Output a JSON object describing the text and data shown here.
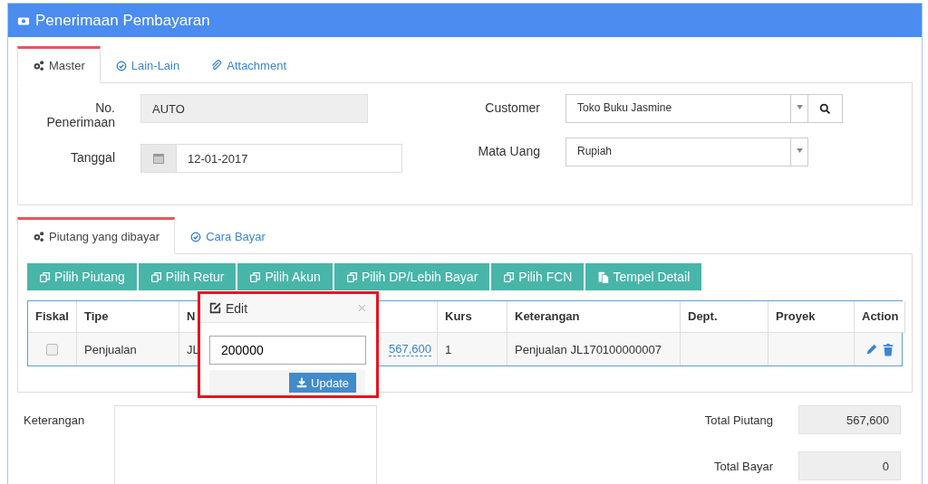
{
  "window": {
    "title": "Penerimaan Pembayaran"
  },
  "master_tabs": [
    {
      "label": "Master",
      "selected": true
    },
    {
      "label": "Lain-Lain",
      "selected": false
    },
    {
      "label": "Attachment",
      "selected": false
    }
  ],
  "master": {
    "no_penerimaan": {
      "label": "No. Penerimaan",
      "value": "AUTO",
      "disabled": true
    },
    "tanggal": {
      "label": "Tanggal",
      "value": "12-01-2017"
    },
    "customer": {
      "label": "Customer",
      "value": "Toko Buku Jasmine"
    },
    "mata_uang": {
      "label": "Mata Uang",
      "value": "Rupiah"
    }
  },
  "detail_tabs": [
    {
      "label": "Piutang yang dibayar",
      "selected": true
    },
    {
      "label": "Cara Bayar",
      "selected": false
    }
  ],
  "buttons": [
    "Pilih Piutang",
    "Pilih Retur",
    "Pilih Akun",
    "Pilih DP/Lebih Bayar",
    "Pilih FCN",
    "Tempel Detail"
  ],
  "table": {
    "columns": [
      "Fiskal",
      "Tipe",
      "N",
      "Kurs",
      "Keterangan",
      "Dept.",
      "Proyek",
      "Action"
    ],
    "rows": [
      {
        "fiskal_checked": false,
        "tipe": "Penjualan",
        "no": "JL",
        "nilai": "567,600",
        "kurs": "1",
        "keterangan": "Penjualan JL170100000007"
      }
    ]
  },
  "edit_popover": {
    "title": "Edit",
    "value": "200000",
    "button": "Update"
  },
  "keterangan": {
    "label": "Keterangan"
  },
  "totals": [
    {
      "label": "Total Piutang",
      "value": "567,600"
    },
    {
      "label": "Total Bayar",
      "value": "0"
    }
  ]
}
